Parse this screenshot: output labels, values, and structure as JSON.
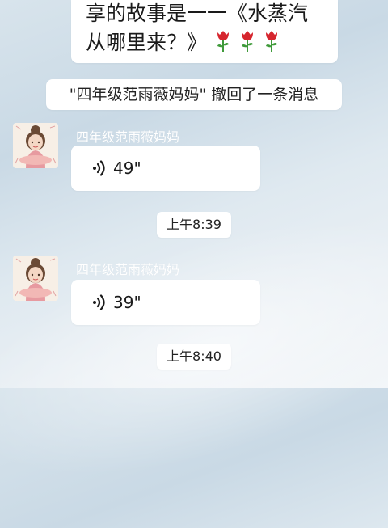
{
  "messages": {
    "top": {
      "line1": "享的故事是一一《水蒸汽",
      "line2": "从哪里来？》",
      "emoji": "rose-icon"
    },
    "system_notice": "\"四年级范雨薇妈妈\" 撤回了一条消息",
    "voice_1": {
      "sender": "四年级范雨薇妈妈",
      "duration": "49\""
    },
    "time_1": "上午8:39",
    "voice_2": {
      "sender": "四年级范雨薇妈妈",
      "duration": "39\""
    },
    "time_2": "上午8:40"
  },
  "colors": {
    "bubble": "#ffffff",
    "rose": "#d6262e",
    "stem": "#3f9a3a"
  }
}
